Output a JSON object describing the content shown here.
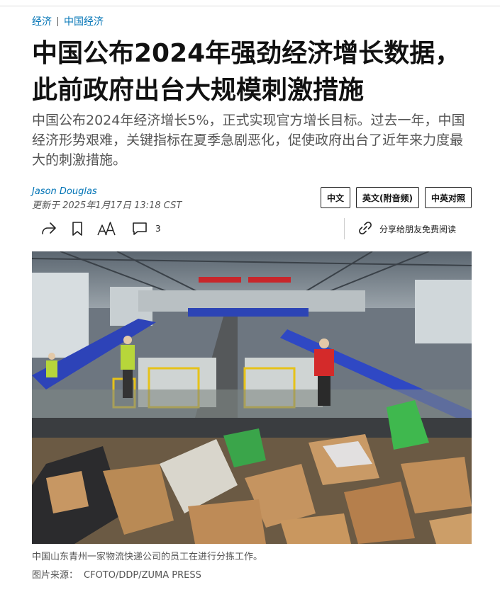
{
  "breadcrumb": {
    "section": "经济",
    "subsection": "中国经济"
  },
  "article": {
    "headline": "中国公布2024年强劲经济增长数据，此前政府出台大规模刺激措施",
    "dek": "中国公布2024年经济增长5%，正式实现官方增长目标。过去一年，中国经济形势艰难，关键指标在夏季急剧恶化，促使政府出台了近年来力度最大的刺激措施。",
    "author": "Jason Douglas",
    "updated": "更新于 2025年1月17日 13:18 CST"
  },
  "language_buttons": {
    "chinese": "中文",
    "english_audio": "英文(附音频)",
    "bilingual": "中英对照"
  },
  "toolbar": {
    "share_icon": "share-arrow-icon",
    "bookmark_icon": "bookmark-icon",
    "text_size_icon": "text-size-icon",
    "comment_icon": "comment-icon",
    "comment_count": "3",
    "gift_icon": "link-icon",
    "gift_label": "分享给朋友免费阅读"
  },
  "image": {
    "description_icon": "warehouse-photo",
    "caption": "中国山东青州一家物流快递公司的员工在进行分拣工作。",
    "credit_label": "图片来源：",
    "credit_value": "CFOTO/DDP/ZUMA PRESS"
  },
  "colors": {
    "link_blue": "#0274b6",
    "text_dark": "#111111",
    "text_gray": "#555555"
  }
}
